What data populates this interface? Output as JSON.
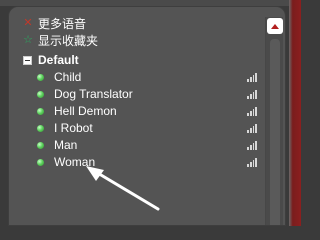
{
  "menu": {
    "more_voices": "更多语音",
    "show_favorites": "显示收藏夹"
  },
  "group": {
    "name": "Default",
    "voices": [
      {
        "name": "Child"
      },
      {
        "name": "Dog Translator"
      },
      {
        "name": "Hell Demon"
      },
      {
        "name": "I Robot"
      },
      {
        "name": "Man"
      },
      {
        "name": "Woman"
      }
    ]
  },
  "icons": {
    "more_voices": "red-x-icon",
    "show_favorites": "green-star-icon",
    "voice_status": "green-dot-icon",
    "voice_signal": "signal-bars-icon",
    "scroll_up": "triangle-up-icon"
  },
  "colors": {
    "panel_bg": "#545454",
    "accent_red": "#b21f1f",
    "status_green": "#5fd35f",
    "text": "#ffffff"
  }
}
